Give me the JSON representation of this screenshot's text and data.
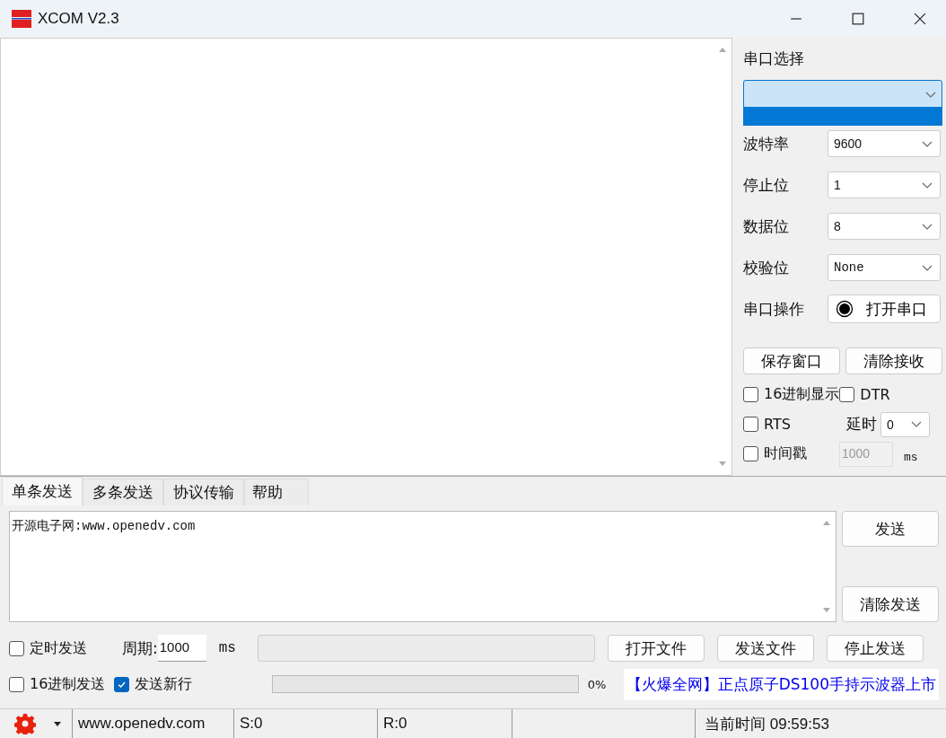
{
  "window": {
    "title": "XCOM V2.3"
  },
  "serial_panel": {
    "port_label": "串口选择",
    "port_select": {
      "expanded": true
    },
    "settings": [
      {
        "label": "波特率",
        "value": "9600",
        "kind": "plain"
      },
      {
        "label": "停止位",
        "value": "1",
        "kind": "plain"
      },
      {
        "label": "数据位",
        "value": "8",
        "kind": "plain"
      },
      {
        "label": "校验位",
        "value": "None",
        "kind": "mono"
      }
    ],
    "operation_label": "串口操作",
    "open_button": "打开串口",
    "buttons": [
      "保存窗口",
      "清除接收"
    ],
    "hex_display": {
      "label": "16进制显示",
      "checked": false
    },
    "dtr": {
      "label": "DTR",
      "checked": false
    },
    "rts": {
      "label": "RTS",
      "checked": false
    },
    "delay_label": "延时",
    "delay_value": "0",
    "timestamp": {
      "label": "时间戳",
      "checked": false
    },
    "timestamp_interval": {
      "value": "1000",
      "disabled": true
    },
    "interval_unit": "ms"
  },
  "tabs": [
    {
      "label": "单条发送",
      "selected": true
    },
    {
      "label": "多条发送",
      "selected": false
    },
    {
      "label": "协议传输",
      "selected": false
    },
    {
      "label": "帮助",
      "selected": false
    }
  ],
  "send_text": "开源电子网:www.openedv.com",
  "send_buttons": [
    "发送",
    "清除发送"
  ],
  "timed_send": {
    "label": "定时发送",
    "checked": false
  },
  "period_label": "周期:",
  "period_value": "1000",
  "period_unit": "ms",
  "hex_send": {
    "label": "16进制发送",
    "checked": false
  },
  "send_newline": {
    "label": "发送新行",
    "checked": true
  },
  "file_buttons": [
    "打开文件",
    "发送文件",
    "停止发送"
  ],
  "progress": {
    "level": 0,
    "reading": "0%"
  },
  "ad_text": "【火爆全网】正点原子DS100手持示波器上市",
  "status_bar": {
    "website": "www.openedv.com",
    "sent": "S:0",
    "received": "R:0",
    "time": "当前时间 09:59:53"
  }
}
